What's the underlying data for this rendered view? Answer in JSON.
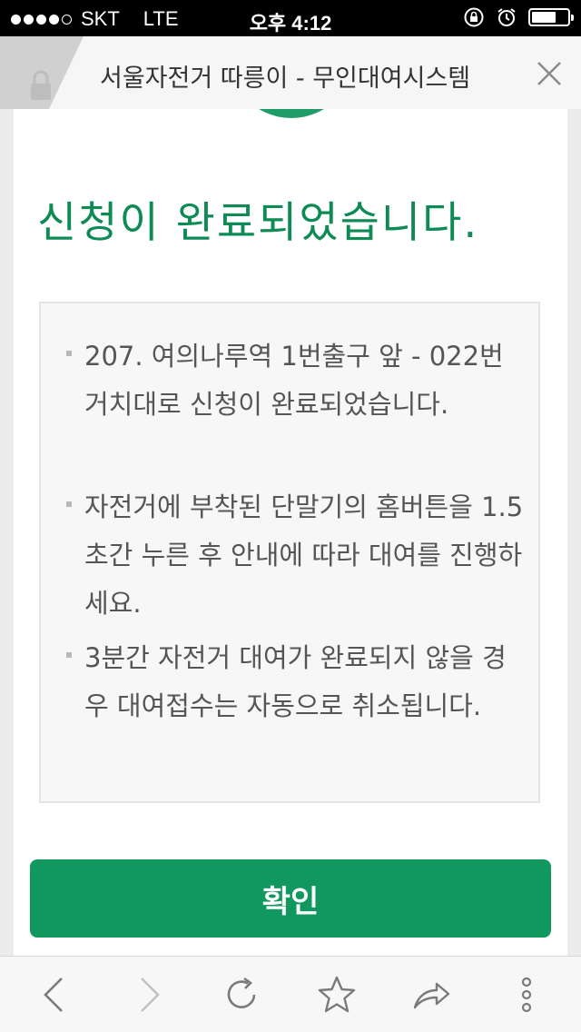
{
  "status_bar": {
    "carrier": "SKT",
    "network": "LTE",
    "time": "오후 4:12",
    "signal_dots_filled": 4,
    "signal_dots_total": 5,
    "battery_level": 0.62,
    "icons": [
      "rotation-lock-icon",
      "alarm-icon",
      "battery-icon"
    ]
  },
  "tab": {
    "title": "서울자전거 따릉이 - 무인대여시스템",
    "icons": [
      "lock-icon",
      "close-icon"
    ]
  },
  "main": {
    "heading": "신청이 완료되었습니다.",
    "info": [
      "207. 여의나루역 1번출구 앞 - 022번 거치대로 신청이 완료되었습니다.",
      "자전거에 부착된 단말기의 홈버튼을 1.5초간 누른 후 안내에 따라 대여를 진행하세요.",
      "3분간 자전거 대여가 완료되지 않을 경우 대여접수는 자동으로 취소됩니다."
    ],
    "confirm_label": "확인"
  },
  "toolbar": {
    "icons": [
      "back-icon",
      "forward-icon",
      "reload-icon",
      "bookmark-star-icon",
      "share-icon",
      "more-icon"
    ]
  },
  "colors": {
    "accent_green": "#0e8b55",
    "button_green": "#11985f"
  }
}
